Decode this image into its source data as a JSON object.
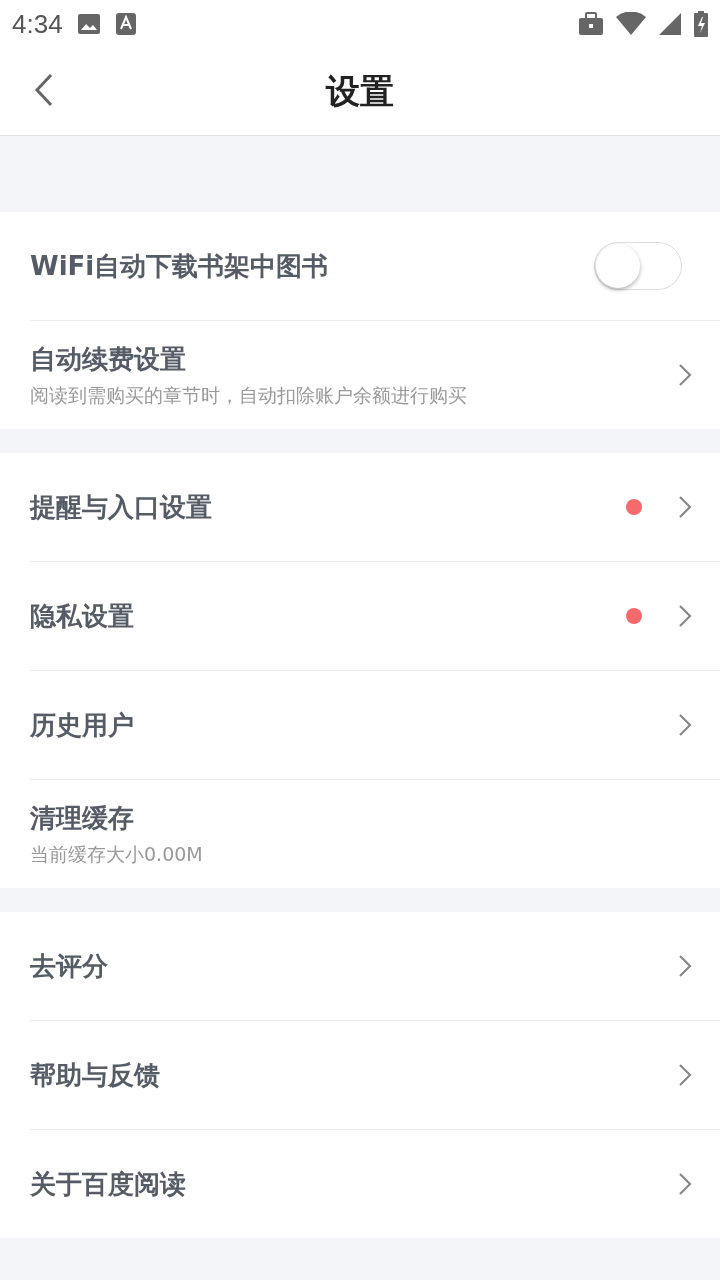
{
  "status_bar": {
    "time": "4:34"
  },
  "header": {
    "title": "设置"
  },
  "sections": [
    {
      "items": [
        {
          "kind": "toggle",
          "label": "WiFi自动下载书架中图书",
          "on": false
        },
        {
          "kind": "link",
          "label": "自动续费设置",
          "subtitle": "阅读到需购买的章节时，自动扣除账户余额进行购买"
        }
      ]
    },
    {
      "items": [
        {
          "kind": "link",
          "label": "提醒与入口设置",
          "badge": true
        },
        {
          "kind": "link",
          "label": "隐私设置",
          "badge": true
        },
        {
          "kind": "link",
          "label": "历史用户"
        },
        {
          "kind": "info",
          "label": "清理缓存",
          "subtitle": "当前缓存大小0.00M"
        }
      ]
    },
    {
      "items": [
        {
          "kind": "link",
          "label": "去评分"
        },
        {
          "kind": "link",
          "label": "帮助与反馈"
        },
        {
          "kind": "link",
          "label": "关于百度阅读"
        }
      ]
    }
  ]
}
